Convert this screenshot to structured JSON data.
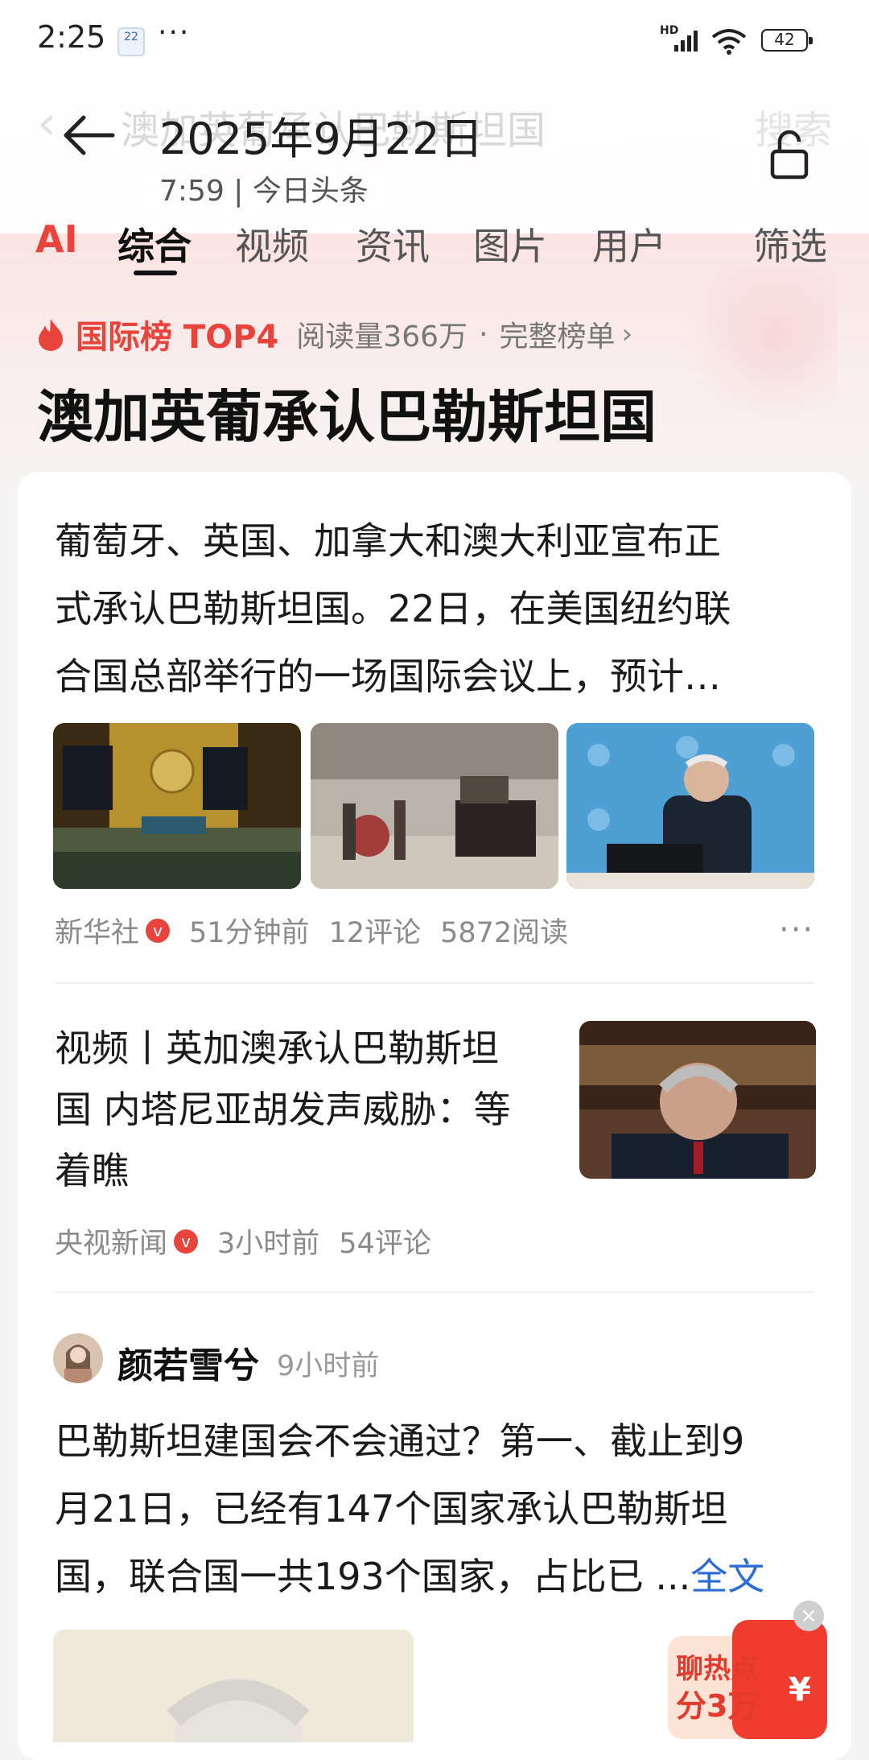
{
  "status_bar": {
    "time": "2:25",
    "calendar_day": "22",
    "more": "···",
    "network": "HD",
    "battery": "42"
  },
  "header": {
    "title": "2025年9月22日",
    "subtitle": "7:59 | 今日头条",
    "ghost_search_text": "澳加英葡承认巴勒斯坦国",
    "ghost_search_button": "搜索"
  },
  "tabs": [
    "AI",
    "综合",
    "视频",
    "资讯",
    "图片",
    "用户",
    "筛选"
  ],
  "ranking": {
    "badge": "国际榜 TOP4",
    "reads": "阅读量366万",
    "dot": "·",
    "full_list": "完整榜单",
    "topic": "澳加英葡承认巴勒斯坦国"
  },
  "articles": [
    {
      "lines": [
        "葡萄牙、英国、加拿大和澳大利亚宣布正",
        "式承认巴勒斯坦国。22日，在美国纽约联",
        "合国总部举行的一场国际会议上，预计…"
      ],
      "source": "新华社",
      "time": "51分钟前",
      "comments": "12评论",
      "reads": "5872阅读"
    },
    {
      "lines": [
        "视频丨英加澳承认巴勒斯坦",
        "国 内塔尼亚胡发声威胁：等",
        "着瞧"
      ],
      "source": "央视新闻",
      "time": "3小时前",
      "comments": "54评论"
    }
  ],
  "post": {
    "author": "颜若雪兮",
    "time": "9小时前",
    "lines": [
      "巴勒斯坦建国会不会通过？第一、截止到9",
      "月21日，已经有147个国家承认巴勒斯坦",
      "国，联合国一共193个国家，占比已 ..."
    ],
    "more_link": "全文"
  },
  "promo": {
    "line1": "聊热点",
    "line2": "分3万",
    "symbol": "¥",
    "close": "×"
  },
  "colors": {
    "accent": "#e8443c",
    "link": "#2d6bd6"
  }
}
